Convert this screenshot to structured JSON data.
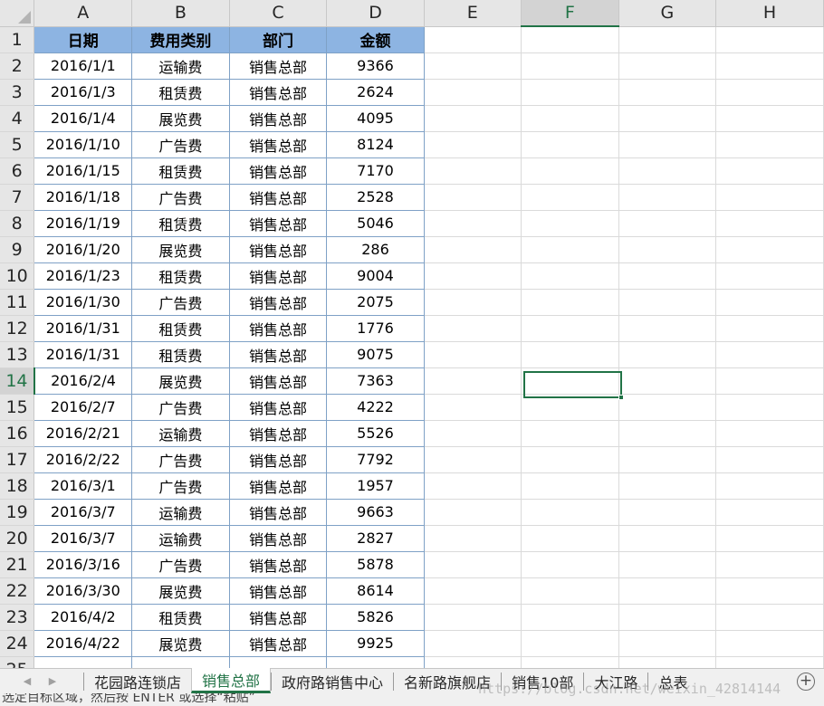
{
  "columns": [
    "A",
    "B",
    "C",
    "D",
    "E",
    "F",
    "G",
    "H"
  ],
  "active_column": "F",
  "active_row": 14,
  "header_row": [
    "日期",
    "费用类别",
    "部门",
    "金额"
  ],
  "rows": [
    [
      "2016/1/1",
      "运输费",
      "销售总部",
      "9366"
    ],
    [
      "2016/1/3",
      "租赁费",
      "销售总部",
      "2624"
    ],
    [
      "2016/1/4",
      "展览费",
      "销售总部",
      "4095"
    ],
    [
      "2016/1/10",
      "广告费",
      "销售总部",
      "8124"
    ],
    [
      "2016/1/15",
      "租赁费",
      "销售总部",
      "7170"
    ],
    [
      "2016/1/18",
      "广告费",
      "销售总部",
      "2528"
    ],
    [
      "2016/1/19",
      "租赁费",
      "销售总部",
      "5046"
    ],
    [
      "2016/1/20",
      "展览费",
      "销售总部",
      "286"
    ],
    [
      "2016/1/23",
      "租赁费",
      "销售总部",
      "9004"
    ],
    [
      "2016/1/30",
      "广告费",
      "销售总部",
      "2075"
    ],
    [
      "2016/1/31",
      "租赁费",
      "销售总部",
      "1776"
    ],
    [
      "2016/1/31",
      "租赁费",
      "销售总部",
      "9075"
    ],
    [
      "2016/2/4",
      "展览费",
      "销售总部",
      "7363"
    ],
    [
      "2016/2/7",
      "广告费",
      "销售总部",
      "4222"
    ],
    [
      "2016/2/21",
      "运输费",
      "销售总部",
      "5526"
    ],
    [
      "2016/2/22",
      "广告费",
      "销售总部",
      "7792"
    ],
    [
      "2016/3/1",
      "广告费",
      "销售总部",
      "1957"
    ],
    [
      "2016/3/7",
      "运输费",
      "销售总部",
      "9663"
    ],
    [
      "2016/3/7",
      "运输费",
      "销售总部",
      "2827"
    ],
    [
      "2016/3/16",
      "广告费",
      "销售总部",
      "5878"
    ],
    [
      "2016/3/30",
      "展览费",
      "销售总部",
      "8614"
    ],
    [
      "2016/4/2",
      "租赁费",
      "销售总部",
      "5826"
    ],
    [
      "2016/4/22",
      "展览费",
      "销售总部",
      "9925"
    ]
  ],
  "sheet_tabs": [
    "花园路连锁店",
    "销售总部",
    "政府路销售中心",
    "名新路旗舰店",
    "销售10部",
    "大江路",
    "总表"
  ],
  "active_tab": "销售总部",
  "nav_icons": [
    "prev-sheet-icon",
    "next-sheet-icon"
  ],
  "add_sheet_icon": "plus-circle-icon",
  "status_text": "选定目标区域，然后按 ENTER 或选择“粘贴”",
  "watermark_text": "https://blog.csdn.net/weixin_42814144",
  "colors": {
    "header_fill": "#8db4e2",
    "table_border": "#7fa1c6",
    "excel_green": "#217346"
  }
}
